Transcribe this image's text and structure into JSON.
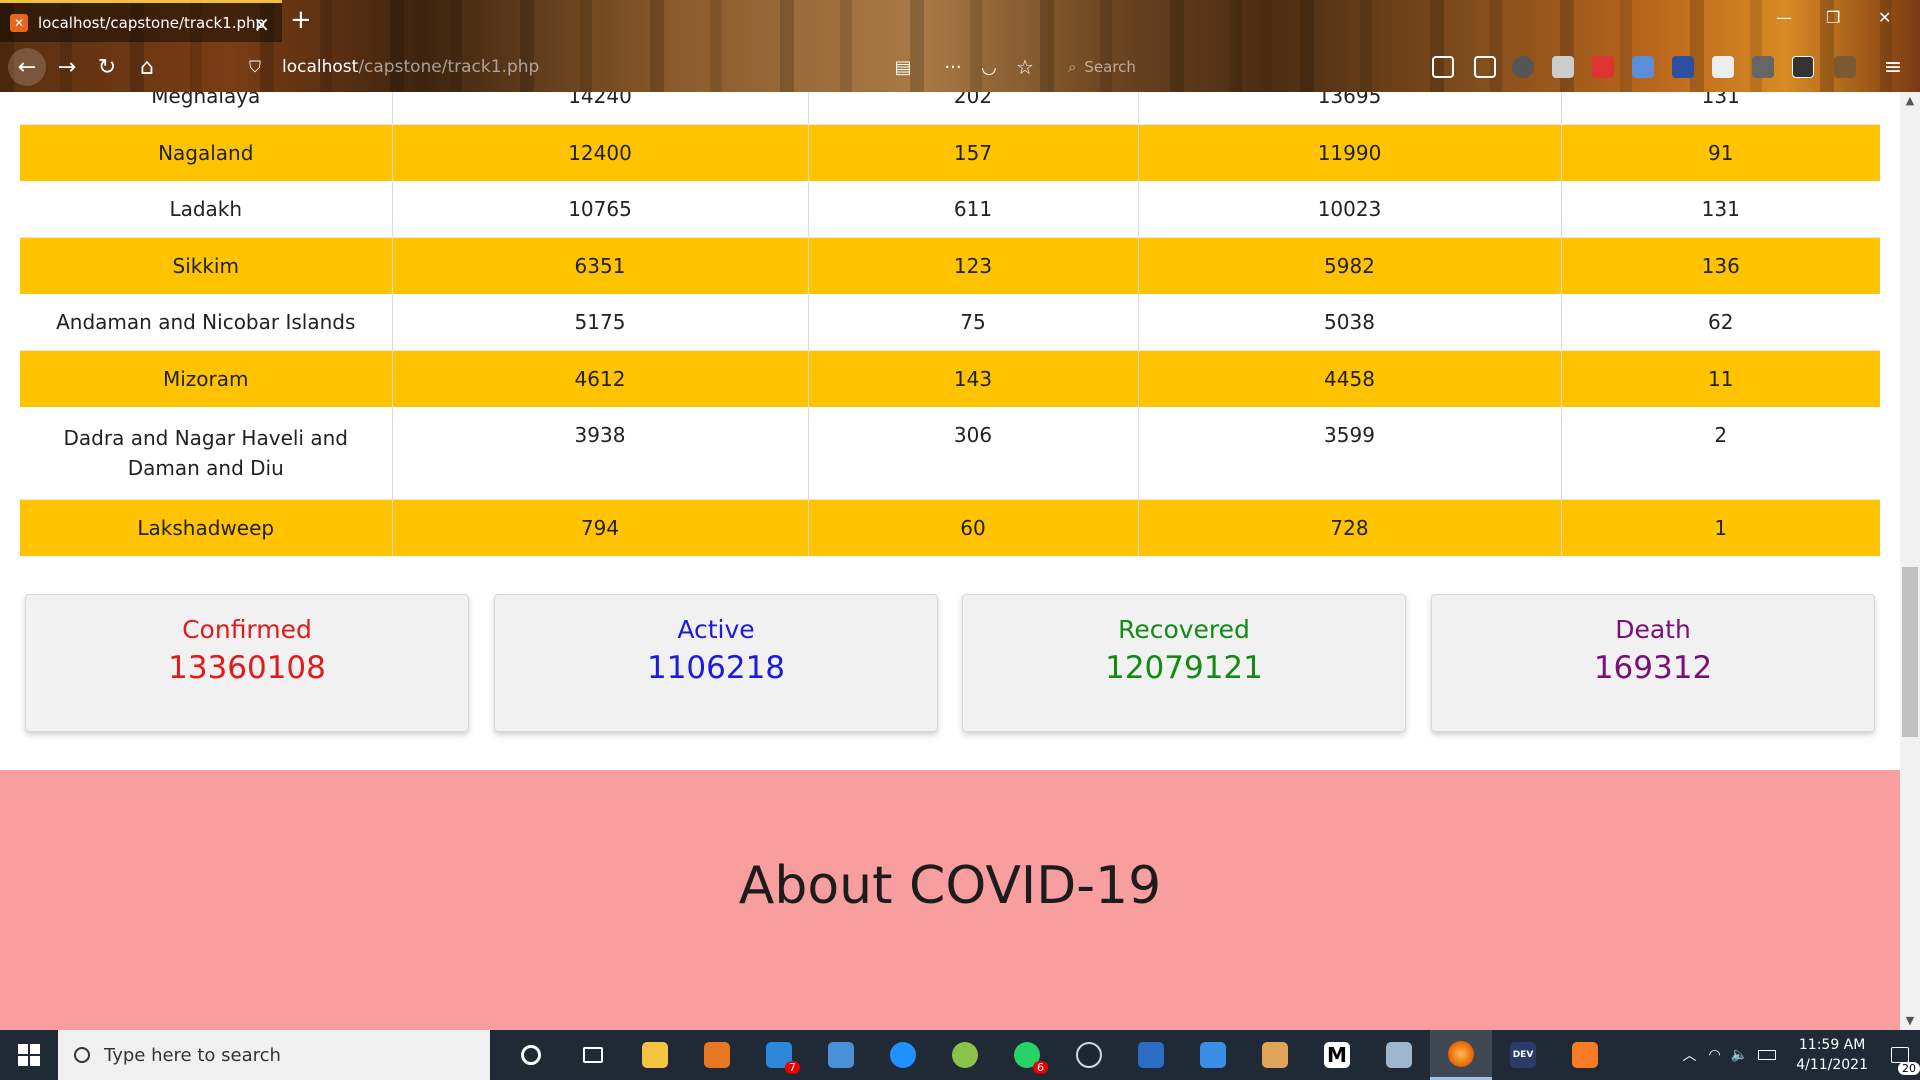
{
  "browser": {
    "tab_title": "localhost/capstone/track1.php",
    "url_host": "localhost",
    "url_path": "/capstone/track1.php",
    "search_placeholder": "Search"
  },
  "table": {
    "partial_row": [
      "Meghalaya",
      "14240",
      "202",
      "13695",
      "131"
    ],
    "rows": [
      [
        "Nagaland",
        "12400",
        "157",
        "11990",
        "91"
      ],
      [
        "Ladakh",
        "10765",
        "611",
        "10023",
        "131"
      ],
      [
        "Sikkim",
        "6351",
        "123",
        "5982",
        "136"
      ],
      [
        "Andaman and Nicobar Islands",
        "5175",
        "75",
        "5038",
        "62"
      ],
      [
        "Mizoram",
        "4612",
        "143",
        "4458",
        "11"
      ],
      [
        "Dadra and Nagar Haveli and Daman and Diu",
        "3938",
        "306",
        "3599",
        "2"
      ],
      [
        "Lakshadweep",
        "794",
        "60",
        "728",
        "1"
      ]
    ]
  },
  "summary": [
    {
      "label": "Confirmed",
      "value": "13360108",
      "color": "#e01b1b"
    },
    {
      "label": "Active",
      "value": "1106218",
      "color": "#1a1ae0"
    },
    {
      "label": "Recovered",
      "value": "12079121",
      "color": "#138a13"
    },
    {
      "label": "Death",
      "value": "169312",
      "color": "#7a0f7a"
    }
  ],
  "about": {
    "title": "About COVID-19"
  },
  "colors": {
    "row_highlight": "#ffc300",
    "about_bg": "#f89e9e"
  },
  "taskbar": {
    "search_placeholder": "Type here to search",
    "time": "11:59 AM",
    "date": "4/11/2021",
    "mail_badge": "7",
    "whatsapp_badge": "6",
    "notification_count": "20"
  }
}
